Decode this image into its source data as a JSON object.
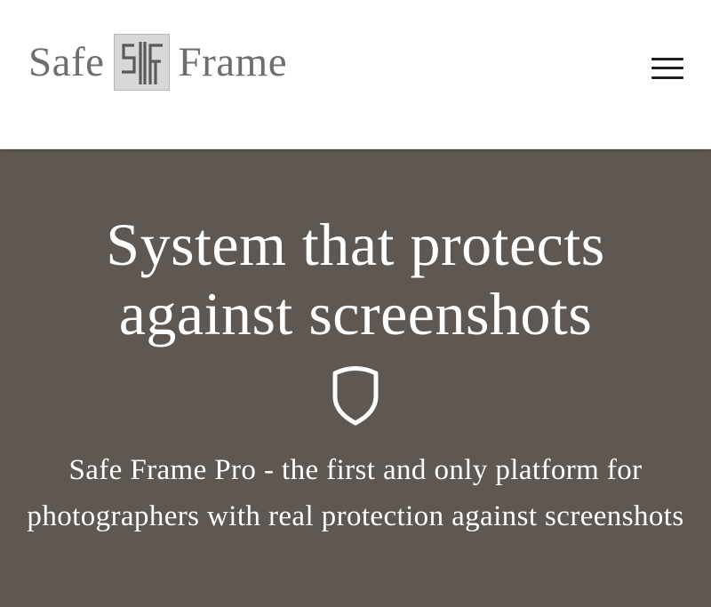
{
  "header": {
    "brand": {
      "left_word": "Safe",
      "right_word": "Frame",
      "logo_letters": "SF",
      "text_color": "#6e6e6e",
      "logo_bg_color": "#d8d8d8"
    },
    "menu_icon": "hamburger-menu-icon"
  },
  "hero": {
    "title": "System that protects against screenshots",
    "icon": "shield-icon",
    "subtitle": "Safe Frame Pro - the first and only platform for photographers with real protection against screenshots",
    "background_color": "#5f5852",
    "text_color": "#ffffff"
  }
}
